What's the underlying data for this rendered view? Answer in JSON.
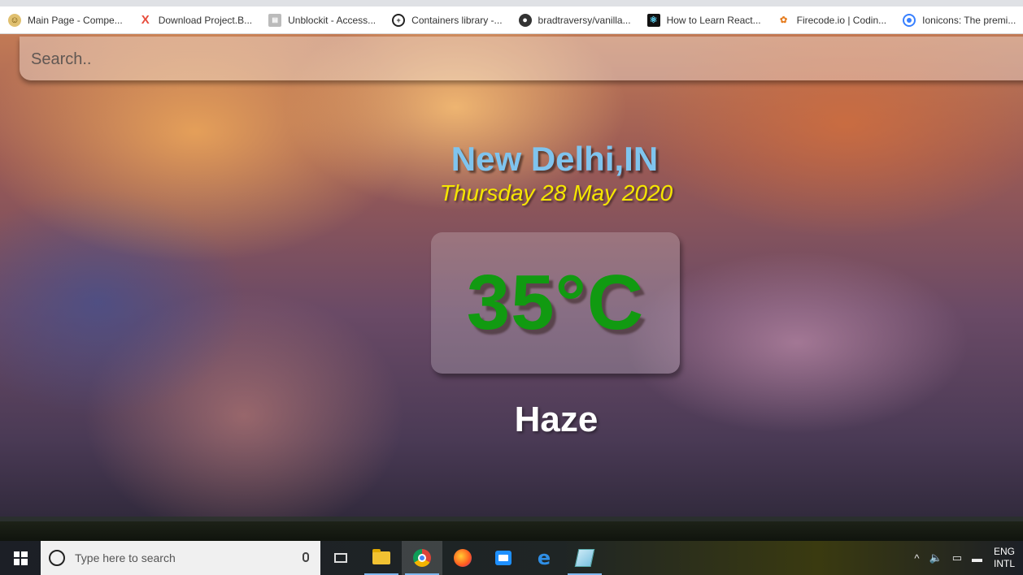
{
  "bookmarks": [
    {
      "label": "Main Page - Compe...",
      "icon": "main-page-favicon"
    },
    {
      "label": "Download Project.B...",
      "icon": "x-favicon"
    },
    {
      "label": "Unblockit - Access...",
      "icon": "unblockit-favicon"
    },
    {
      "label": "Containers library -...",
      "icon": "cplusplus-favicon"
    },
    {
      "label": "bradtraversy/vanilla...",
      "icon": "github-favicon"
    },
    {
      "label": "How to Learn React...",
      "icon": "react-favicon"
    },
    {
      "label": "Firecode.io | Codin...",
      "icon": "firecode-favicon"
    },
    {
      "label": "Ionicons: The premi...",
      "icon": "ionicons-favicon"
    }
  ],
  "search": {
    "placeholder": "Search.."
  },
  "weather": {
    "location": "New Delhi,IN",
    "date": "Thursday 28 May 2020",
    "temperature": "35°C",
    "condition": "Haze"
  },
  "colors": {
    "location": "#7fc4ee",
    "date": "#f5e600",
    "temperature": "#119a11",
    "condition": "#ffffff"
  },
  "taskbar": {
    "search_placeholder": "Type here to search",
    "apps": [
      "task-view",
      "file-explorer",
      "chrome",
      "firefox",
      "messaging",
      "edge",
      "notes"
    ],
    "language_top": "ENG",
    "language_bottom": "INTL"
  }
}
